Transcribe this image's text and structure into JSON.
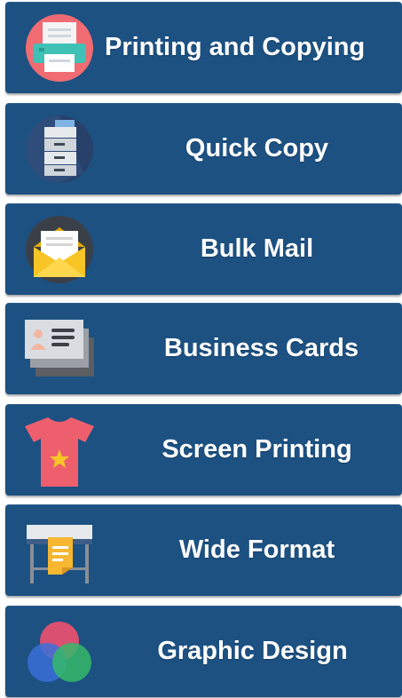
{
  "menu": {
    "items": [
      {
        "label": "Printing and Copying",
        "icon": "printer-icon"
      },
      {
        "label": "Quick Copy",
        "icon": "copier-icon"
      },
      {
        "label": "Bulk Mail",
        "icon": "envelope-icon"
      },
      {
        "label": "Business Cards",
        "icon": "business-card-icon"
      },
      {
        "label": "Screen Printing",
        "icon": "tshirt-icon"
      },
      {
        "label": "Wide Format",
        "icon": "plotter-icon"
      },
      {
        "label": "Graphic Design",
        "icon": "color-circles-icon"
      }
    ]
  },
  "colors": {
    "tile_background": "#1c5182",
    "label_text": "#ffffff"
  }
}
